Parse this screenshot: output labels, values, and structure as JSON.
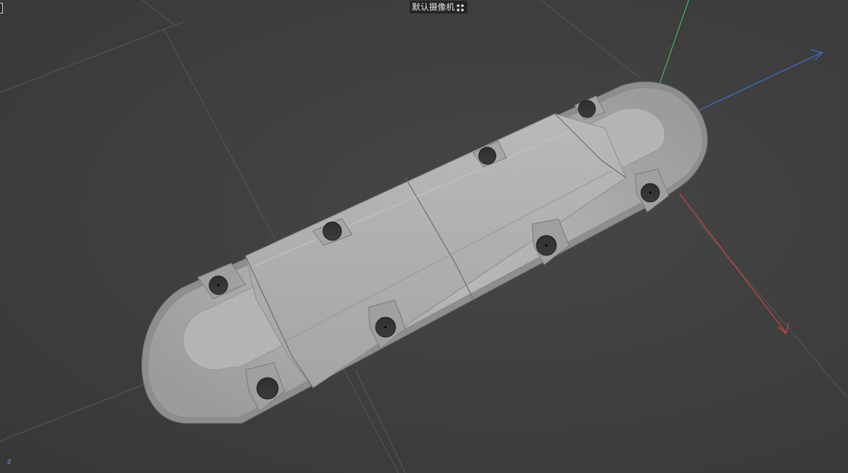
{
  "viewport": {
    "camera_label": "默认摄像机",
    "camera_icon": "camera-options-icon",
    "axis_label": "z"
  },
  "colors": {
    "background": "#3e3e3e",
    "grid": "#575757",
    "axis_x": "#d0453e",
    "axis_y": "#3fb85a",
    "axis_z": "#3f6fd4",
    "model": "#a9a9a9"
  }
}
